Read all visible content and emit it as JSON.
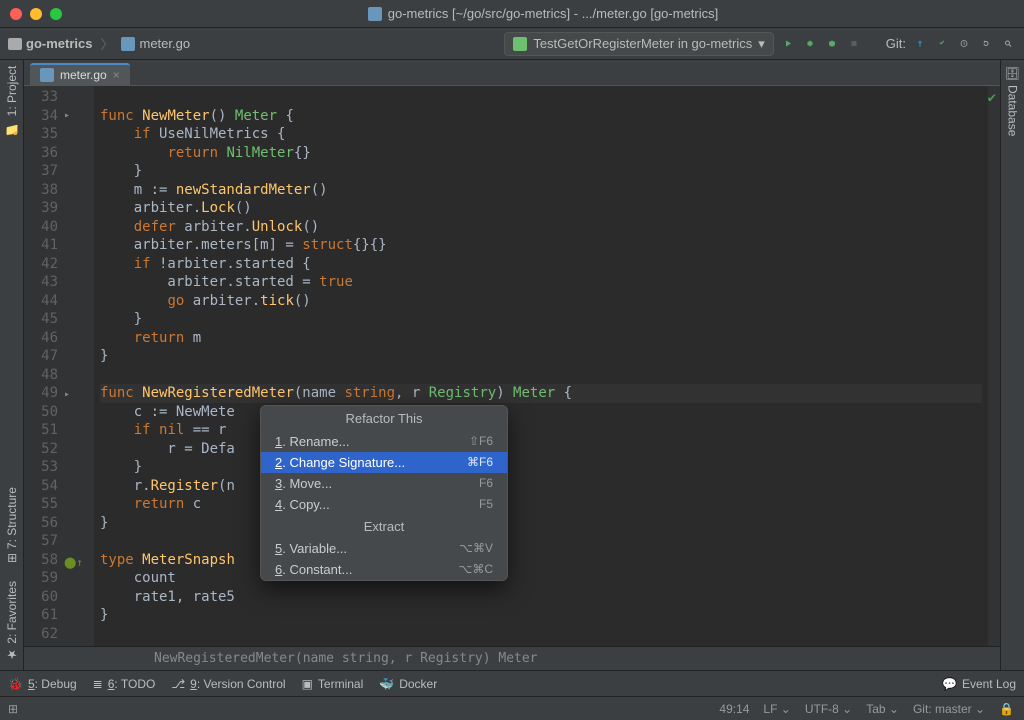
{
  "title": "go-metrics [~/go/src/go-metrics] - .../meter.go [go-metrics]",
  "breadcrumb": {
    "project": "go-metrics",
    "file": "meter.go"
  },
  "run_config": "TestGetOrRegisterMeter in go-metrics",
  "git_label": "Git:",
  "tab": {
    "name": "meter.go"
  },
  "side_left": [
    "1: Project",
    "7: Structure",
    "2: Favorites"
  ],
  "side_right": [
    "Database"
  ],
  "gutter_start": 33,
  "code_lines": [
    "",
    "func NewMeter() Meter {",
    "    if UseNilMetrics {",
    "        return NilMeter{}",
    "    }",
    "    m := newStandardMeter()",
    "    arbiter.Lock()",
    "    defer arbiter.Unlock()",
    "    arbiter.meters[m] = struct{}{}",
    "    if !arbiter.started {",
    "        arbiter.started = true",
    "        go arbiter.tick()",
    "    }",
    "    return m",
    "}",
    "",
    "func NewRegisteredMeter(name string, r Registry) Meter {",
    "    c := NewMete",
    "    if nil == r",
    "        r = Defa",
    "    }",
    "    r.Register(n",
    "    return c",
    "}",
    "",
    "type MeterSnapsh",
    "    count",
    "    rate1, rate5",
    "}",
    ""
  ],
  "caret_line_index": 16,
  "popup": {
    "title": "Refactor This",
    "items": [
      {
        "n": "1",
        "label": "Rename...",
        "shortcut": "⇧F6"
      },
      {
        "n": "2",
        "label": "Change Signature...",
        "shortcut": "⌘F6",
        "selected": true
      },
      {
        "n": "3",
        "label": "Move...",
        "shortcut": "F6"
      },
      {
        "n": "4",
        "label": "Copy...",
        "shortcut": "F5"
      }
    ],
    "section": "Extract",
    "items2": [
      {
        "n": "5",
        "label": "Variable...",
        "shortcut": "⌥⌘V"
      },
      {
        "n": "6",
        "label": "Constant...",
        "shortcut": "⌥⌘C"
      }
    ]
  },
  "breadcrumb_signature": "NewRegisteredMeter(name string, r Registry) Meter",
  "bottom_tools": [
    {
      "icon": "bug",
      "label": "5: Debug"
    },
    {
      "icon": "list",
      "label": "6: TODO"
    },
    {
      "icon": "vcs",
      "label": "9: Version Control"
    },
    {
      "icon": "term",
      "label": "Terminal"
    },
    {
      "icon": "dock",
      "label": "Docker"
    }
  ],
  "event_log": "Event Log",
  "status": {
    "pos": "49:14",
    "sep": "LF",
    "enc": "UTF-8",
    "indent": "Tab",
    "branch": "Git: master",
    "lock": "🔒"
  }
}
